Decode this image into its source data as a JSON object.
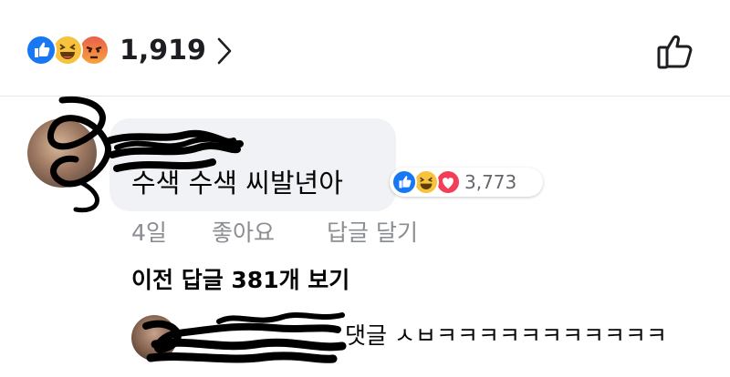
{
  "reactions_header": {
    "icons": [
      "like-icon",
      "haha-icon",
      "angry-icon"
    ],
    "total": "1,919",
    "colors": {
      "like": "#1877f2",
      "haha": "#f7c33e",
      "angry": "#e9604a"
    }
  },
  "comment": {
    "text": "수색 수색 씨발년아",
    "reactions": {
      "icons": [
        "like-icon",
        "haha-icon",
        "love-icon"
      ],
      "count": "3,773"
    },
    "time": "4일",
    "like_label": "좋아요",
    "reply_label": "답글 달기"
  },
  "previous_replies_label": "이전 답글 381개 보기",
  "latest_reply": {
    "text": "댓글 ㅅㅂㅋㅋㅋㅋㅋㅋㅋㅋㅋㅋㅋ"
  }
}
